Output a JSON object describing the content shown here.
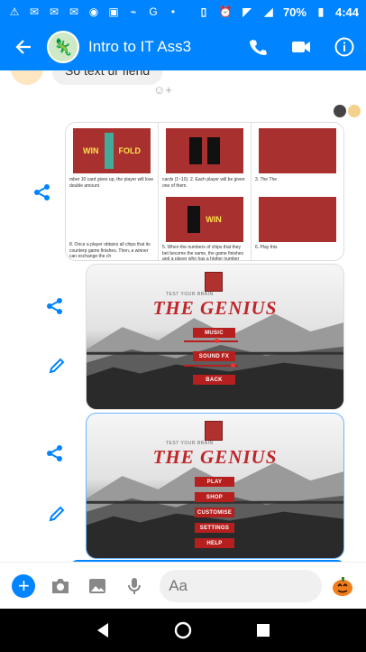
{
  "status_bar": {
    "battery": "70%",
    "time": "4:44",
    "notification_icons": [
      "alert-icon",
      "gmail-icon",
      "gmail-icon",
      "gmail-icon",
      "talk-icon",
      "nfc-icon",
      "activity-icon",
      "google-icon",
      "dots-icon"
    ]
  },
  "header": {
    "title": "Intro to IT Ass3"
  },
  "previous_message": {
    "text": "So text ur fiend"
  },
  "rules_card": {
    "col1_text1": "mber 10 card gives up, the player will lose double amount",
    "col1_text2": "8. Once a player obtains all chips that its counterp game finishes. Then, a winner can exchange the ch",
    "col2_text1": "cards (1~10).    2. Each player will be given one of them.",
    "col2_text2": "5. When the numbers of chips that they bet become the same, the game finishes and a player who has a higher number wins.",
    "col3_text1": "3. The The",
    "col3_text2": "6. Play this",
    "win_label": "WIN",
    "fold_label": "FOLD"
  },
  "game_screen_1": {
    "subtitle": "TEST YOUR BRAIN",
    "title": "THE GENIUS",
    "buttons": [
      "MUSIC",
      "SOUND FX",
      "BACK"
    ]
  },
  "game_screen_2": {
    "subtitle": "TEST YOUR BRAIN",
    "title": "THE GENIUS",
    "buttons": [
      "PLAY",
      "SHOP",
      "CUSTOMISE",
      "SETTINGS",
      "HELP"
    ]
  },
  "composer": {
    "placeholder": "Aa"
  },
  "colors": {
    "messenger_blue": "#0084ff",
    "game_red": "#b5201f"
  }
}
